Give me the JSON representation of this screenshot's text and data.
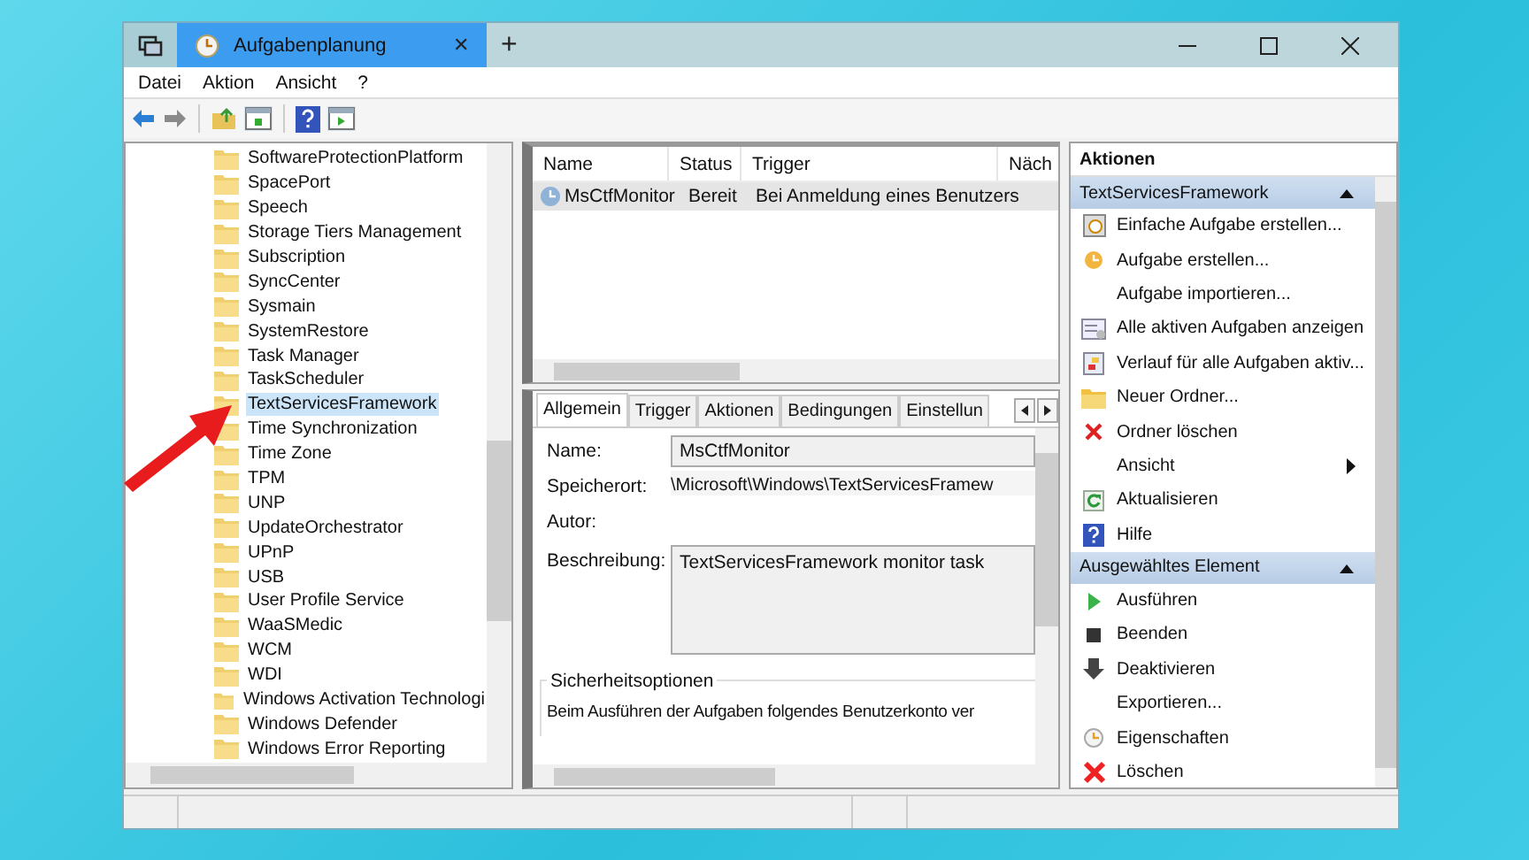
{
  "window": {
    "tab_title": "Aufgabenplanung",
    "close": "✕",
    "new_tab": "+"
  },
  "menu": [
    "Datei",
    "Aktion",
    "Ansicht",
    "?"
  ],
  "tree": {
    "items": [
      {
        "label": "SoftwareProtectionPlatform",
        "selected": false
      },
      {
        "label": "SpacePort",
        "selected": false
      },
      {
        "label": "Speech",
        "selected": false
      },
      {
        "label": "Storage Tiers Management",
        "selected": false
      },
      {
        "label": "Subscription",
        "selected": false
      },
      {
        "label": "SyncCenter",
        "selected": false
      },
      {
        "label": "Sysmain",
        "selected": false
      },
      {
        "label": "SystemRestore",
        "selected": false
      },
      {
        "label": "Task Manager",
        "selected": false
      },
      {
        "label": "TaskScheduler",
        "selected": false
      },
      {
        "label": "TextServicesFramework",
        "selected": true
      },
      {
        "label": "Time Synchronization",
        "selected": false
      },
      {
        "label": "Time Zone",
        "selected": false
      },
      {
        "label": "TPM",
        "selected": false
      },
      {
        "label": "UNP",
        "selected": false
      },
      {
        "label": "UpdateOrchestrator",
        "selected": false
      },
      {
        "label": "UPnP",
        "selected": false
      },
      {
        "label": "USB",
        "selected": false
      },
      {
        "label": "User Profile Service",
        "selected": false
      },
      {
        "label": "WaaSMedic",
        "selected": false
      },
      {
        "label": "WCM",
        "selected": false
      },
      {
        "label": "WDI",
        "selected": false
      },
      {
        "label": "Windows Activation Technologi",
        "selected": false
      },
      {
        "label": "Windows Defender",
        "selected": false
      },
      {
        "label": "Windows Error Reporting",
        "selected": false
      }
    ]
  },
  "task_list": {
    "columns": [
      "Name",
      "Status",
      "Trigger",
      "Näch"
    ],
    "rows": [
      {
        "cells": [
          "MsCtfMonitor",
          "Bereit",
          "Bei Anmeldung eines Benutzers"
        ],
        "selected": true
      }
    ]
  },
  "details": {
    "tabs": [
      {
        "label": "Allgemein",
        "selected": true
      },
      {
        "label": "Trigger",
        "selected": false
      },
      {
        "label": "Aktionen",
        "selected": false
      },
      {
        "label": "Bedingungen",
        "selected": false
      },
      {
        "label": "Einstellun",
        "selected": false
      }
    ],
    "fields": [
      {
        "label": "Name:",
        "value": "MsCtfMonitor",
        "kind": "box"
      },
      {
        "label": "Speicherort:",
        "value": "\\Microsoft\\Windows\\TextServicesFramew",
        "kind": "text"
      },
      {
        "label": "Autor:",
        "kind": "text"
      },
      {
        "label": "Beschreibung:",
        "value": "TextServicesFramework monitor task",
        "kind": "area"
      }
    ],
    "security": {
      "title": "Sicherheitsoptionen",
      "text": "Beim Ausführen der Aufgaben folgendes Benutzerkonto ver"
    }
  },
  "actions": {
    "title": "Aktionen",
    "sections": [
      {
        "title": "TextServicesFramework",
        "expanded": true,
        "items": [
          {
            "label": "Einfache Aufgabe erstellen...",
            "kind": "wizard"
          },
          {
            "label": "Aufgabe erstellen...",
            "kind": "task"
          },
          {
            "label": "Aufgabe importieren...",
            "kind": "plain"
          },
          {
            "label": "Alle aktiven Aufgaben anzeigen",
            "kind": "list"
          },
          {
            "label": "Verlauf für alle Aufgaben aktiv...",
            "kind": "history"
          },
          {
            "label": "Neuer Ordner...",
            "kind": "folder"
          },
          {
            "label": "Ordner löschen",
            "kind": "delete"
          },
          {
            "label": "Ansicht",
            "kind": "submenu"
          },
          {
            "label": "Aktualisieren",
            "kind": "refresh"
          },
          {
            "label": "Hilfe",
            "kind": "help"
          }
        ]
      },
      {
        "title": "Ausgewähltes Element",
        "expanded": true,
        "items": [
          {
            "label": "Ausführen",
            "kind": "run"
          },
          {
            "label": "Beenden",
            "kind": "stop"
          },
          {
            "label": "Deaktivieren",
            "kind": "disable"
          },
          {
            "label": "Exportieren...",
            "kind": "plain"
          },
          {
            "label": "Eigenschaften",
            "kind": "properties"
          },
          {
            "label": "Löschen",
            "kind": "bigdelete"
          }
        ]
      }
    ]
  }
}
